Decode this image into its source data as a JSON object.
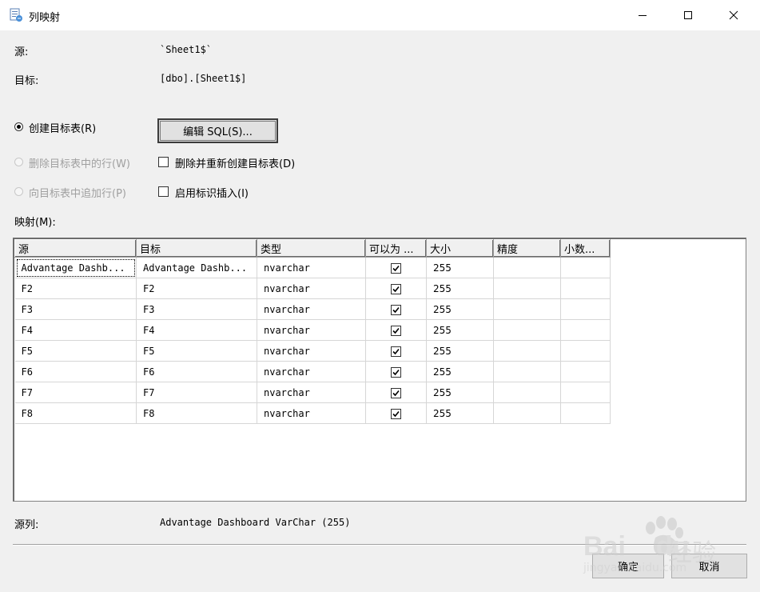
{
  "window": {
    "title": "列映射",
    "minimize_glyph": "—",
    "maximize_glyph": "☐",
    "close_glyph": "✕"
  },
  "source": {
    "label": "源:",
    "value": "`Sheet1$`"
  },
  "target": {
    "label": "目标:",
    "value": "[dbo].[Sheet1$]"
  },
  "options": {
    "create_table": "创建目标表(R)",
    "delete_rows": "删除目标表中的行(W)",
    "append_rows": "向目标表中追加行(P)",
    "edit_sql": "编辑 SQL(S)...",
    "drop_recreate": "删除并重新创建目标表(D)",
    "enable_identity": "启用标识插入(I)"
  },
  "mapping_label": "映射(M):",
  "grid": {
    "columns": [
      "源",
      "目标",
      "类型",
      "可以为 ...",
      "大小",
      "精度",
      "小数..."
    ],
    "rows": [
      {
        "source": "Advantage Dashb...",
        "target": "Advantage Dashb...",
        "type": "nvarchar",
        "nullable": true,
        "size": "255",
        "precision": "",
        "scale": ""
      },
      {
        "source": "F2",
        "target": "F2",
        "type": "nvarchar",
        "nullable": true,
        "size": "255",
        "precision": "",
        "scale": ""
      },
      {
        "source": "F3",
        "target": "F3",
        "type": "nvarchar",
        "nullable": true,
        "size": "255",
        "precision": "",
        "scale": ""
      },
      {
        "source": "F4",
        "target": "F4",
        "type": "nvarchar",
        "nullable": true,
        "size": "255",
        "precision": "",
        "scale": ""
      },
      {
        "source": "F5",
        "target": "F5",
        "type": "nvarchar",
        "nullable": true,
        "size": "255",
        "precision": "",
        "scale": ""
      },
      {
        "source": "F6",
        "target": "F6",
        "type": "nvarchar",
        "nullable": true,
        "size": "255",
        "precision": "",
        "scale": ""
      },
      {
        "source": "F7",
        "target": "F7",
        "type": "nvarchar",
        "nullable": true,
        "size": "255",
        "precision": "",
        "scale": ""
      },
      {
        "source": "F8",
        "target": "F8",
        "type": "nvarchar",
        "nullable": true,
        "size": "255",
        "precision": "",
        "scale": ""
      }
    ]
  },
  "source_column": {
    "label": "源列:",
    "value": "Advantage Dashboard VarChar (255)"
  },
  "buttons": {
    "ok": "确定",
    "cancel": "取消"
  },
  "watermark": {
    "brand": "Bai",
    "brand2": "du",
    "suffix": "经验",
    "url": "jingyan.baidu.com"
  }
}
